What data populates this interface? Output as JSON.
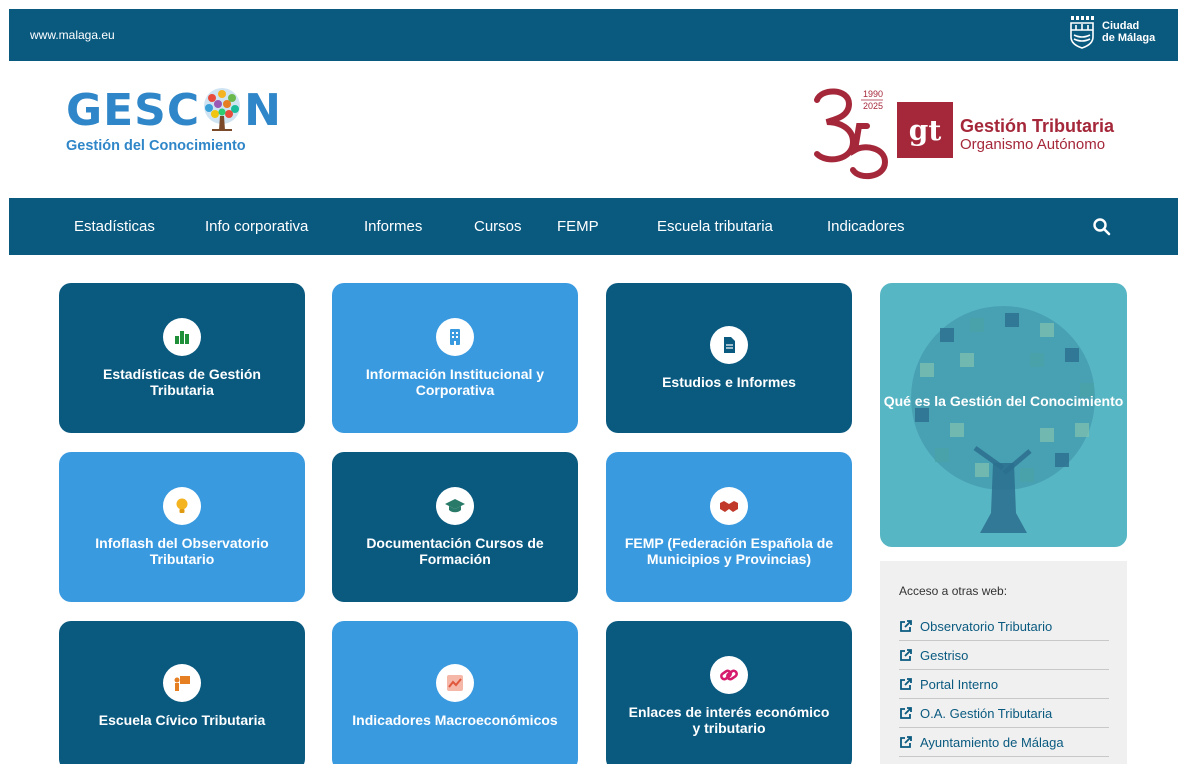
{
  "topbar": {
    "url": "www.malaga.eu",
    "city_line1": "Ciudad",
    "city_line2": "de Málaga",
    "bg": "#0a5a80"
  },
  "header": {
    "brand_prefix": "GESC",
    "brand_suffix": "N",
    "brand_sub": "Gestión del Conocimiento",
    "anniv_years_top": "1990",
    "anniv_years_bottom": "2025",
    "anniv_number": "35",
    "gt_logo": "gt",
    "gt_name": "Gestión Tributaria",
    "gt_sub": "Organismo Autónomo",
    "gt_color": "#a5283a"
  },
  "nav": {
    "items": [
      "Estadísticas",
      "Info corporativa",
      "Informes",
      "Cursos",
      "FEMP",
      "Escuela tributaria",
      "Indicadores"
    ],
    "search_icon": "search-icon"
  },
  "tiles": [
    {
      "label": "Estadísticas de Gestión Tributaria",
      "icon": "bar-chart-icon",
      "style": "dark"
    },
    {
      "label": "Información Institucional y Corporativa",
      "icon": "building-icon",
      "style": "light"
    },
    {
      "label": "Estudios e Informes",
      "icon": "document-icon",
      "style": "dark"
    },
    {
      "label": "Infoflash del Observatorio Tributario",
      "icon": "lightbulb-icon",
      "style": "light"
    },
    {
      "label": "Documentación Cursos de Formación",
      "icon": "graduation-cap-icon",
      "style": "dark"
    },
    {
      "label": "FEMP (Federación Española de Municipios y Provincias)",
      "icon": "handshake-icon",
      "style": "light"
    },
    {
      "label": "Escuela Cívico Tributaria",
      "icon": "teacher-icon",
      "style": "dark"
    },
    {
      "label": "Indicadores Macroeconómicos",
      "icon": "line-chart-icon",
      "style": "light"
    },
    {
      "label": "Enlaces de interés económico y tributario",
      "icon": "link-icon",
      "style": "dark"
    }
  ],
  "feature": {
    "label": "Qué es la Gestión del Conocimiento"
  },
  "links": {
    "title": "Acceso a otras web:",
    "items": [
      "Observatorio Tributario",
      "Gestriso",
      "Portal Interno",
      "O.A. Gestión Tributaria",
      "Ayuntamiento de Málaga"
    ]
  },
  "colors": {
    "dark_tile": "#0a5a80",
    "light_tile": "#3a9ae0",
    "feature_bg": "#57b6c4"
  }
}
